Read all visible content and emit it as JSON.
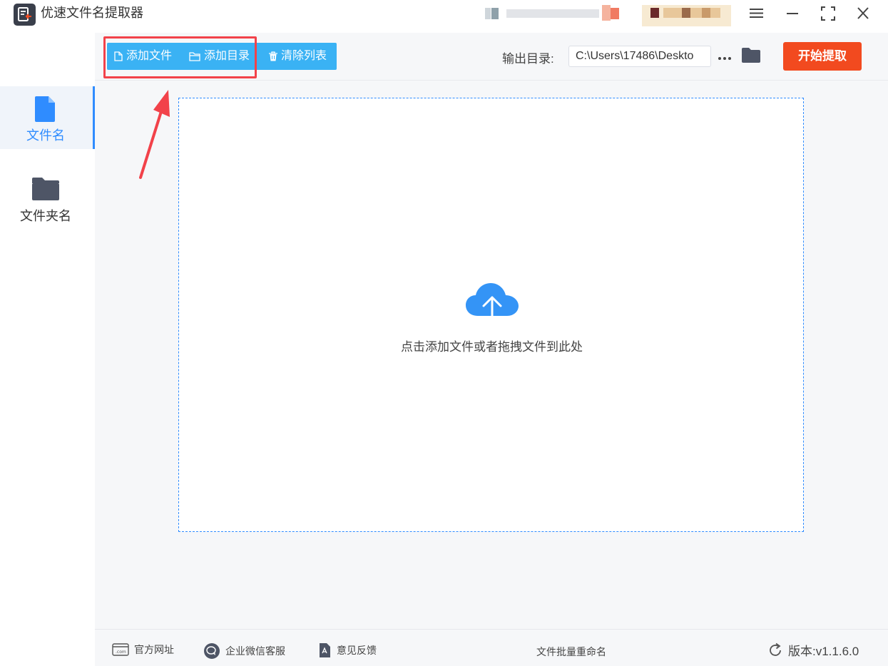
{
  "app": {
    "title": "优速文件名提取器"
  },
  "sidebar": {
    "items": [
      {
        "label": "文件名",
        "icon": "file-icon",
        "active": true
      },
      {
        "label": "文件夹名",
        "icon": "folder-icon",
        "active": false
      }
    ]
  },
  "toolbar": {
    "add_file_label": "添加文件",
    "add_dir_label": "添加目录",
    "clear_list_label": "清除列表",
    "output_label": "输出目录:",
    "output_path": "C:\\Users\\17486\\Deskto",
    "start_label": "开始提取"
  },
  "dropzone": {
    "hint": "点击添加文件或者拖拽文件到此处"
  },
  "footer": {
    "website_label": "官方网址",
    "wechat_label": "企业微信客服",
    "feedback_label": "意见反馈",
    "center_label": "文件批量重命名",
    "version_label": "版本:v1.1.6.0"
  },
  "colors": {
    "accent": "#2f8cff",
    "toolbar_button": "#3ab2f4",
    "start_button": "#f24a1f",
    "highlight": "#f2424a"
  }
}
